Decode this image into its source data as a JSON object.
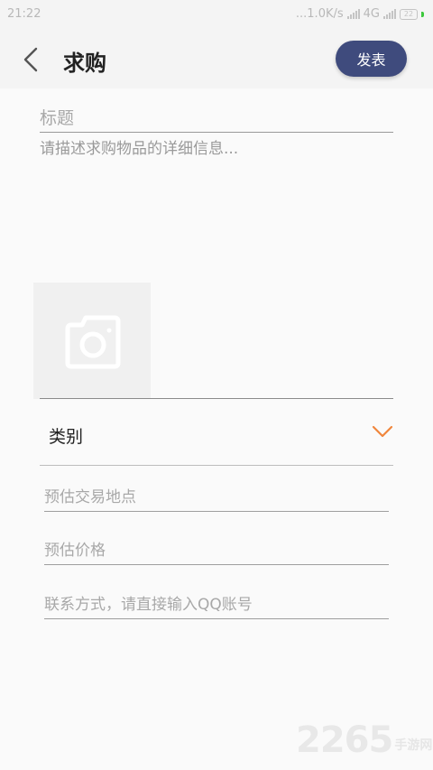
{
  "status_bar": {
    "time": "21:22",
    "network_speed": "...1.0K/s",
    "network_type": "4G",
    "battery": "22"
  },
  "header": {
    "title": "求购",
    "publish_label": "发表"
  },
  "form": {
    "title_placeholder": "标题",
    "description_placeholder": "请描述求购物品的详细信息...",
    "category_label": "类别",
    "location_placeholder": "预估交易地点",
    "price_placeholder": "预估价格",
    "contact_placeholder": "联系方式，请直接输入QQ账号"
  },
  "watermark": {
    "number": "2265",
    "text": "手游网"
  },
  "colors": {
    "accent_button": "#3f4b7d",
    "chevron": "#f0863c",
    "background": "#fafafa"
  }
}
